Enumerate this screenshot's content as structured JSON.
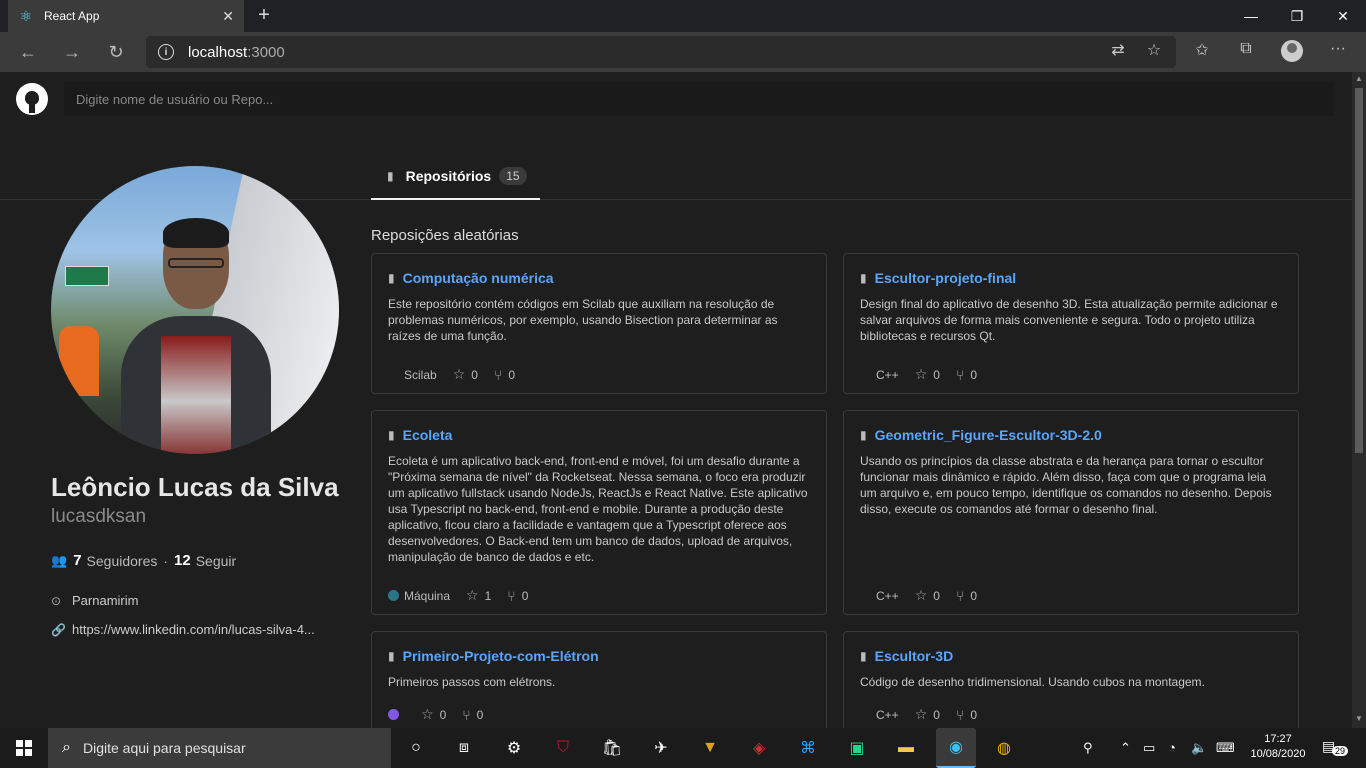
{
  "browser": {
    "tab_title": "React App",
    "url_host": "localhost",
    "url_port": ":3000"
  },
  "search": {
    "placeholder": "Digite nome de usuário ou Repo..."
  },
  "profile": {
    "name": "Leôncio Lucas da Silva",
    "login": "lucasdksan",
    "followers": "7",
    "followers_label": "Seguidores",
    "following": "12",
    "following_label": "Seguir",
    "location": "Parnamirim",
    "blog": "https://www.linkedin.com/in/lucas-silva-4..."
  },
  "tabs": {
    "repositories_label": "Repositórios",
    "repositories_count": "15"
  },
  "section_title": "Reposições aleatórias",
  "repos": [
    {
      "name": "Computação numérica",
      "description": "Este repositório contém códigos em Scilab que auxiliam na resolução de problemas numéricos, por exemplo, usando Bisection para determinar as raízes de uma função.",
      "language": "Scilab",
      "language_color": "",
      "stars": "0",
      "forks": "0"
    },
    {
      "name": "Escultor-projeto-final",
      "description": "Design final do aplicativo de desenho 3D. Esta atualização permite adicionar e salvar arquivos de forma mais conveniente e segura. Todo o projeto utiliza bibliotecas e recursos Qt.",
      "language": "C++",
      "language_color": "",
      "stars": "0",
      "forks": "0"
    },
    {
      "name": "Ecoleta",
      "description": "Ecoleta é um aplicativo back-end, front-end e móvel, foi um desafio durante a \"Próxima semana de nível\" da Rocketseat. Nessa semana, o foco era produzir um aplicativo fullstack usando NodeJs, ReactJs e React Native. Este aplicativo usa Typescript no back-end, front-end e mobile. Durante a produção deste aplicativo, ficou claro a facilidade e vantagem que a Typescript oferece aos desenvolvedores. O Back-end tem um banco de dados, upload de arquivos, manipulação de banco de dados e etc.",
      "language": "Máquina",
      "language_color": "#2b7489",
      "stars": "1",
      "forks": "0"
    },
    {
      "name": "Geometric_Figure-Escultor-3D-2.0",
      "description": "Usando os princípios da classe abstrata e da herança para tornar o escultor funcionar mais dinâmico e rápido. Além disso, faça com que o programa leia um arquivo e, em pouco tempo, identifique os comandos no desenho. Depois disso, execute os comandos até formar o desenho final.",
      "language": "C++",
      "language_color": "",
      "stars": "0",
      "forks": "0"
    },
    {
      "name": "Primeiro-Projeto-com-Elétron",
      "description": "Primeiros passos com elétrons.",
      "language": "",
      "language_color": "#8257e5",
      "stars": "0",
      "forks": "0"
    },
    {
      "name": "Escultor-3D",
      "description": "Código de desenho tridimensional. Usando cubos na montagem.",
      "language": "C++",
      "language_color": "",
      "stars": "0",
      "forks": "0"
    }
  ],
  "taskbar": {
    "search_text": "Digite aqui para pesquisar",
    "time": "17:27",
    "date": "10/08/2020",
    "notifications": "29"
  }
}
